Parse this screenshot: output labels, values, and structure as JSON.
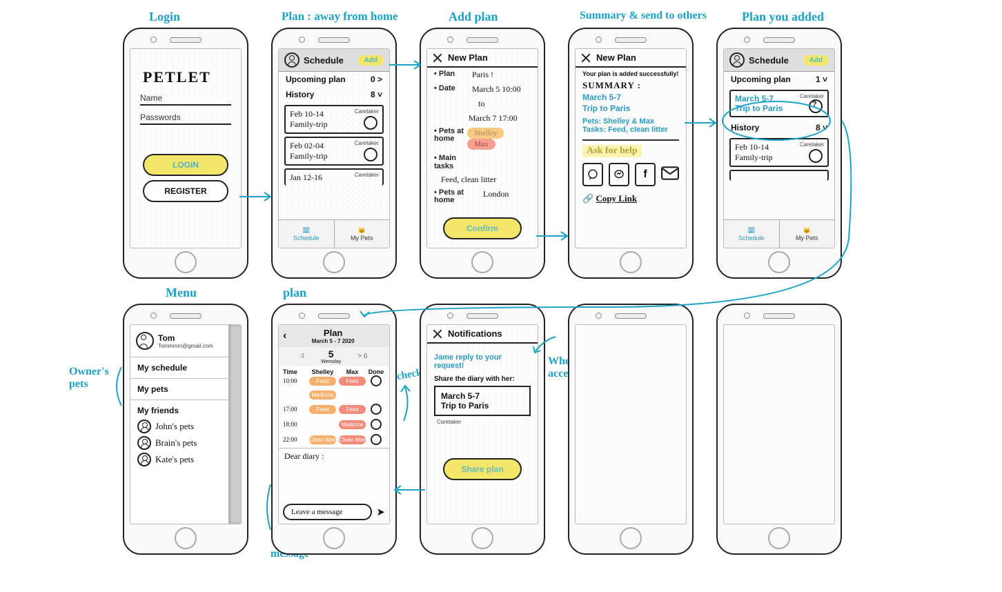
{
  "annotations": {
    "login": "Login",
    "plan_away": "Plan : away from home",
    "add_plan": "Add plan",
    "summary": "Summary & send to others",
    "plan_added": "Plan you added",
    "menu": "Menu",
    "plan": "plan",
    "check": "check",
    "message": "message",
    "owners_pets": "Owner's\npets",
    "when_jame": "When Jame\naccept your request"
  },
  "login": {
    "brand": "PETLET",
    "name_label": "Name",
    "password_label": "Passwords",
    "login_btn": "LOGIN",
    "register_btn": "REGISTER"
  },
  "schedule1": {
    "title": "Schedule",
    "add": "Add",
    "upcoming_label": "Upcoming plan",
    "upcoming_count": "0 >",
    "history_label": "History",
    "history_count": "8 ˅",
    "caretaker": "Caretaker",
    "cards": [
      {
        "dates": "Feb 10-14",
        "title": "Family-trip"
      },
      {
        "dates": "Feb 02-04",
        "title": "Family-trip"
      },
      {
        "dates": "Jan 12-16",
        "title": ""
      }
    ],
    "tab_schedule": "Schedule",
    "tab_pets": "My Pets"
  },
  "newplan": {
    "title": "New Plan",
    "plan_label": "Plan",
    "plan_value": "Paris !",
    "date_label": "Date",
    "date_value1": "March 5  10:00",
    "date_to": "to",
    "date_value2": "March 7  17:00",
    "pets_label": "Pets at home",
    "pet1": "Shelley",
    "pet2": "Max",
    "tasks_label": "Main tasks",
    "tasks_value": "Feed, clean litter",
    "loc_label": "Pets at home",
    "loc_value": "London",
    "confirm": "Confirm"
  },
  "summary": {
    "title": "New Plan",
    "success": "Your plan is added successfully!",
    "heading": "SUMMARY :",
    "dates": "March 5-7",
    "trip": "Trip to Paris",
    "pets": "Pets: Shelley & Max",
    "tasks": "Tasks: Feed, clean litter",
    "ask": "Ask for help",
    "copy": "Copy Link"
  },
  "schedule2": {
    "title": "Schedule",
    "add": "Add",
    "upcoming_label": "Upcoming plan",
    "upcoming_count": "1 ˅",
    "new_dates": "March 5-7",
    "new_title": "Trip to Paris",
    "caretaker": "Caretaker",
    "history_label": "History",
    "history_count": "8 ˅",
    "card_dates": "Feb 10-14",
    "card_title": "Family-trip",
    "tab_schedule": "Schedule",
    "tab_pets": "My Pets"
  },
  "menu": {
    "name": "Tom",
    "email": "Tommmm@gmail.com",
    "my_schedule": "My schedule",
    "my_pets": "My pets",
    "my_friends": "My friends",
    "friends": [
      "John's pets",
      "Brain's pets",
      "Kate's pets"
    ]
  },
  "plandetail": {
    "title": "Plan",
    "subtitle": "March 5 - 7 2020",
    "dayprev": "4",
    "day": "5",
    "dayname": "Wensday",
    "daynext": "> 6",
    "col_time": "Time",
    "col_shelley": "Shelley",
    "col_max": "Max",
    "col_done": "Done",
    "rows": [
      {
        "t": "10:00",
        "s": "Feed",
        "m": "Feed"
      },
      {
        "t": "",
        "s": "Medicine",
        "m": ""
      },
      {
        "t": "17:00",
        "s": "Feed",
        "m": "Feed"
      },
      {
        "t": "18:00",
        "s": "",
        "m": "Medicine"
      },
      {
        "t": "22:00",
        "s": "Clean litter",
        "m": "Clean litter"
      }
    ],
    "diary": "Dear diary :",
    "msg_placeholder": "Leave a message"
  },
  "notif": {
    "title": "Notifications",
    "reply": "Jame reply to your request!",
    "share_label": "Share the diary with her:",
    "box_dates": "March 5-7",
    "box_title": "Trip to Paris",
    "caretaker": "Caretaker",
    "share_btn": "Share plan"
  }
}
